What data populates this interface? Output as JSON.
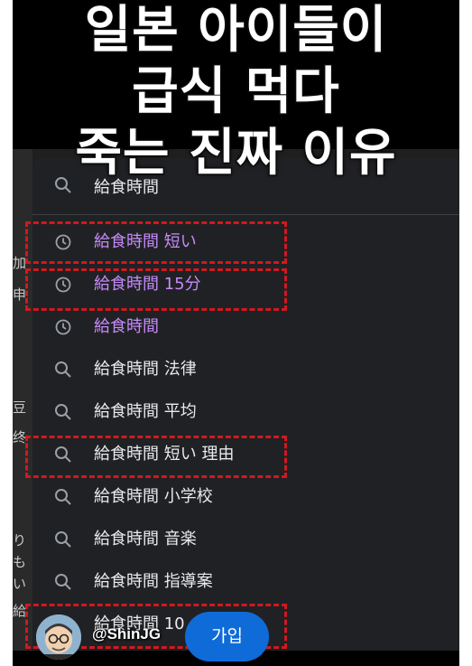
{
  "headline": {
    "line1": "일본 아이들이",
    "line2": "급식 먹다",
    "line3": "죽는 진짜 이유"
  },
  "search": {
    "query": "給食時間"
  },
  "suggestions": [
    {
      "text": "給食時間 短い",
      "icon": "history-clock-icon",
      "visited": true
    },
    {
      "text": "給食時間 15分",
      "icon": "history-clock-icon",
      "visited": true
    },
    {
      "text": "給食時間",
      "icon": "history-clock-icon",
      "visited": true
    },
    {
      "text": "給食時間 法律",
      "icon": "search-icon",
      "visited": false
    },
    {
      "text": "給食時間 平均",
      "icon": "search-icon",
      "visited": false
    },
    {
      "text": "給食時間 短い 理由",
      "icon": "search-icon",
      "visited": false
    },
    {
      "text": "給食時間 小学校",
      "icon": "search-icon",
      "visited": false
    },
    {
      "text": "給食時間 音楽",
      "icon": "search-icon",
      "visited": false
    },
    {
      "text": "給食時間 指導案",
      "icon": "search-icon",
      "visited": false
    },
    {
      "text": "給食時間 10",
      "icon": "search-icon",
      "visited": false
    }
  ],
  "left_strip": [
    "加",
    "申",
    "豆",
    "终",
    "り",
    "も",
    "い",
    "給"
  ],
  "channel": {
    "handle": "@ShinJG",
    "join_label": "가입"
  },
  "colors": {
    "highlight_dash": "#d0191f",
    "visited_link": "#c58af9",
    "join_button": "#0f6bd8",
    "panel_bg": "#202124"
  }
}
